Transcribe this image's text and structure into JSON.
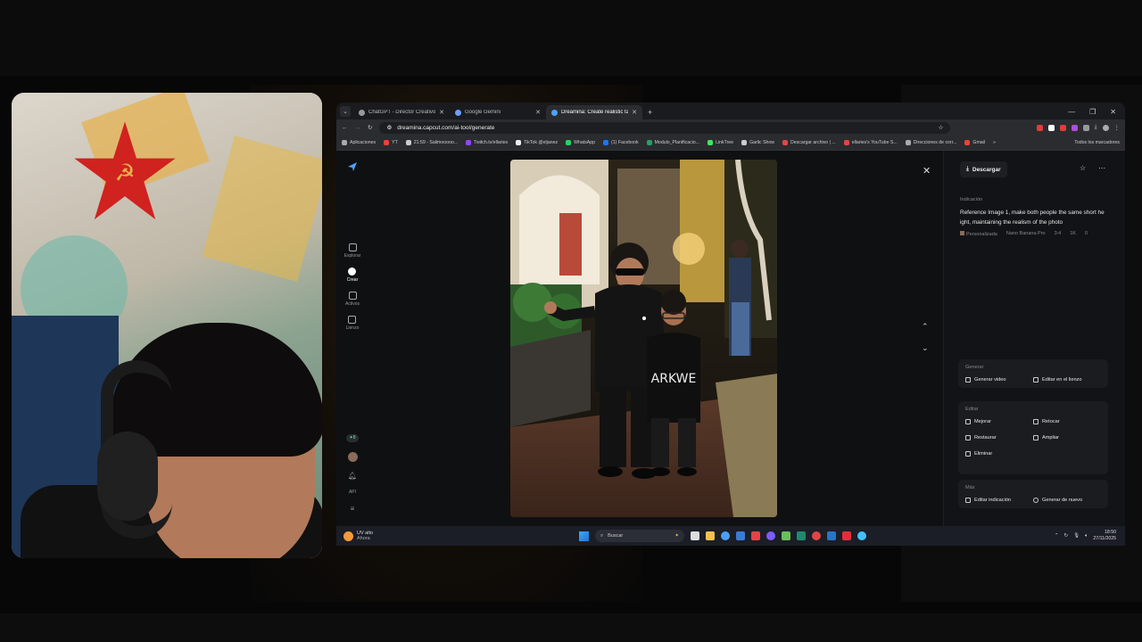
{
  "browser": {
    "tabs": [
      {
        "title": "ChatGPT - Director Creativo So",
        "active": false
      },
      {
        "title": "Google Gemini",
        "active": false
      },
      {
        "title": "Dreamina: Create realistic talki",
        "active": true
      }
    ],
    "new_tab": "+",
    "url": "dreamina.capcut.com/ai-tool/generate",
    "bookmarks": [
      {
        "label": "Aplicaciones",
        "color": "#aaaaaa"
      },
      {
        "label": "YT",
        "color": "#ff3b3b"
      },
      {
        "label": "21:59 - Salimooooo...",
        "color": "#cccccc"
      },
      {
        "label": "Twitch.tv/ellaries",
        "color": "#9146ff"
      },
      {
        "label": "TikTok @eljanez",
        "color": "#eeeeee"
      },
      {
        "label": "WhatsApp",
        "color": "#25d366"
      },
      {
        "label": "(1) Facebook",
        "color": "#1877f2"
      },
      {
        "label": "Modulo_Planificacio...",
        "color": "#1fa463"
      },
      {
        "label": "LinkTree",
        "color": "#43e55e"
      },
      {
        "label": "Garlic Show",
        "color": "#cccccc"
      },
      {
        "label": "Descargar archivo | ...",
        "color": "#e04545"
      },
      {
        "label": "ellaries's YouTube S...",
        "color": "#e04545"
      },
      {
        "label": "Direcciones de corr...",
        "color": "#aaaaaa"
      },
      {
        "label": "Gmail",
        "color": "#ea4335"
      }
    ],
    "all_bookmarks": "Todos los marcadores",
    "more": "»"
  },
  "rail": {
    "items": [
      {
        "label": "Explorar",
        "icon": "home-icon",
        "active": false
      },
      {
        "label": "Crear",
        "icon": "create-icon",
        "active": true
      },
      {
        "label": "Activos",
        "icon": "folder-icon",
        "active": false
      },
      {
        "label": "Lienzo",
        "icon": "canvas-icon",
        "active": false
      }
    ],
    "credits": "8",
    "api": "API"
  },
  "panel": {
    "download": "Descargar",
    "prompt_label": "Indicación",
    "prompt": "Reference Image 1, make both people the same short he ight, maintaining the realism of the photo",
    "meta": [
      "Personalizada",
      "Nano Banana Pro",
      "3:4",
      "1K",
      "0"
    ],
    "generate": {
      "title": "Generar",
      "actions": [
        "Generar video",
        "Editar en el lienzo"
      ]
    },
    "edit": {
      "title": "Editar",
      "actions": [
        "Mejorar",
        "Retocar",
        "Restaurar",
        "Ampliar",
        "Eliminar"
      ]
    },
    "more": {
      "title": "Más",
      "actions": [
        "Editar indicación",
        "Generar de nuevo"
      ]
    }
  },
  "taskbar": {
    "weather_title": "UV alto",
    "weather_sub": "Ahora",
    "search_placeholder": "Buscar",
    "time": "18:50",
    "date": "27/11/2025"
  },
  "photo": {
    "shirt_text": "ARKWE"
  }
}
